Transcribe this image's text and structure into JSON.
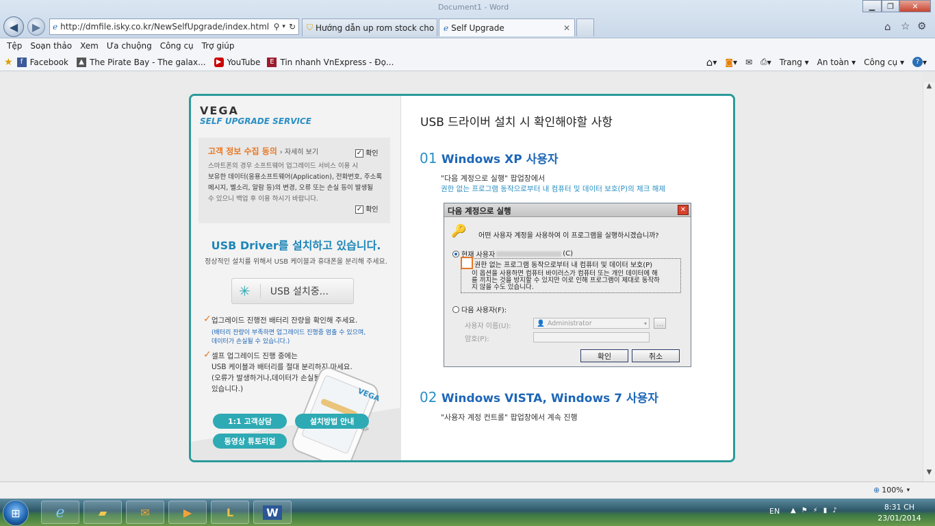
{
  "browser": {
    "window_title": "Document1 - Word",
    "url": "http://dmfile.isky.co.kr/NewSelfUpgrade/index.html",
    "tabs": [
      {
        "label": "Hướng dẫn up rom stock cho ..."
      },
      {
        "label": "Self Upgrade"
      }
    ],
    "menu": [
      "Tệp",
      "Soạn thảo",
      "Xem",
      "Ưa chuộng",
      "Công cụ",
      "Trợ giúp"
    ],
    "favorites": [
      {
        "label": "Facebook",
        "color": "#3b5998",
        "glyph": "f"
      },
      {
        "label": "The Pirate Bay - The galax...",
        "color": "#444444",
        "glyph": "▲"
      },
      {
        "label": "YouTube",
        "color": "#cc0000",
        "glyph": "▶"
      },
      {
        "label": "Tin nhanh VnExpress - Đọ...",
        "color": "#9b1c2e",
        "glyph": "E"
      }
    ],
    "commands": [
      "Trang",
      "An toàn",
      "Công cụ"
    ],
    "zoom": "100%"
  },
  "left": {
    "logo": "VEGA",
    "service": "SELF UPGRADE SERVICE",
    "consent_title": "고객 정보 수집 동의",
    "consent_more": "› 자세히 보기",
    "confirm_label": "확인",
    "consent_lines": [
      "스마트폰의 경우 소프트웨어 업그레이드 서비스 이용 시",
      "보유한 데이터(응용소프트웨어(Application), 전화번호, 주소록",
      "메시지, 벨소리, 알람 등)의 변경, 오류 또는 손실 등이 발생될",
      "수 있으니 백업 후 이용 하시기 바랍니다."
    ],
    "heading": "USB Driver를 설치하고 있습니다.",
    "subtext": "정상적인 설치를 위해서 USB 케이블과 휴대폰을 분리해 주세요.",
    "install_btn": "USB 설치중...",
    "note1_title": "업그레이드 진행전 배터리 잔량을 확인해 주세요.",
    "note1_detail": [
      "(배터리 잔량이 부족하면 업그레이드 진행중 멈출 수 있으며,",
      "데이터가 손실될 수 있습니다.)"
    ],
    "note2_lines": [
      "셀프 업그레이드 진행 중에는",
      "USB 케이블과 배터리를 절대 분리하지 마세요.",
      "(오류가 발생하거나,데이터가 손실될 수",
      "있습니다.)"
    ],
    "phone_brand": "VEGA",
    "phone_label": "UP&P",
    "btn_support": "1:1 고객상담",
    "btn_guide": "설치방법 안내",
    "btn_video": "동영상 튜토리얼"
  },
  "right": {
    "title": "USB 드라이버 설치 시 확인해야할 사항",
    "s1_num": "01",
    "s1_title": "Windows XP 사용자",
    "s1_line1": "\"다음 계정으로 실행\" 팝업창에서",
    "s1_line2": "권한 없는 프로그램 동작으로부터 내 컴퓨터 및 데이터 보호(P)의 체크 해제",
    "s2_num": "02",
    "s2_title": "Windows VISTA, Windows 7 사용자",
    "s2_line1": "\"사용자 계정 컨트롤\" 팝업창에서 계속 진행"
  },
  "dialog": {
    "title": "다음 계정으로 실행",
    "question": "어떤 사용자 계정을 사용하여 이 프로그램을 실행하시겠습니까?",
    "current_user": "현재 사용자",
    "current_user_key": "(C)",
    "protect_label": "권한 없는 프로그램 동작으로부터 내 컴퓨터 및 데이터 보호(P)",
    "protect_desc": [
      "이 옵션을 사용하면 컴퓨터 바이러스가 컴퓨터 또는 개인 데이터에 해",
      "를 끼치는 것을 방지할 수 있지만 이로 인해 프로그램이 제대로 동작하",
      "지 않을 수도 있습니다."
    ],
    "other_user": "다음 사용자(F):",
    "username_label": "사용자 이름(U):",
    "username_value": "Administrator",
    "password_label": "암호(P):",
    "ok": "확인",
    "cancel": "취소",
    "browse": "..."
  },
  "taskbar": {
    "lang": "EN",
    "time": "8:31 CH",
    "date": "23/01/2014"
  },
  "colors": {
    "teal": "#2a9a9a",
    "orange": "#e87722",
    "blue_link": "#2a8fc4"
  }
}
